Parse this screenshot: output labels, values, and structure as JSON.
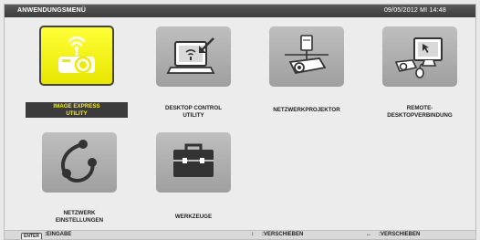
{
  "window": {
    "title": "ANWENDUNGSMENÜ",
    "datetime": "09/05/2012 MI 14:48"
  },
  "tiles": [
    {
      "label": "IMAGE EXPRESS\nUTILITY",
      "icon": "wireless-projector-icon",
      "selected": true
    },
    {
      "label": "DESKTOP CONTROL\nUTILITY",
      "icon": "laptop-wireless-icon",
      "selected": false
    },
    {
      "label": "NETZWERKPROJEKTOR",
      "icon": "network-projector-icon",
      "selected": false
    },
    {
      "label": "REMOTE-\nDESKTOPVERBINDUNG",
      "icon": "remote-desktop-icon",
      "selected": false
    },
    {
      "label": "NETZWERK\nEINSTELLUNGEN",
      "icon": "network-settings-icon",
      "selected": false
    },
    {
      "label": "WERKZEUGE",
      "icon": "toolbox-icon",
      "selected": false
    }
  ],
  "footer": {
    "enter_key": "ENTER",
    "enter_label": ":EINGABE",
    "move_label_1": ":VERSCHIEBEN",
    "move_label_2": ":VERSCHIEBEN"
  },
  "colors": {
    "titlebar": "#444444",
    "tile": "#ababab",
    "selected_tile": "#f5f000",
    "selected_label_bg": "#3b3b3b"
  }
}
